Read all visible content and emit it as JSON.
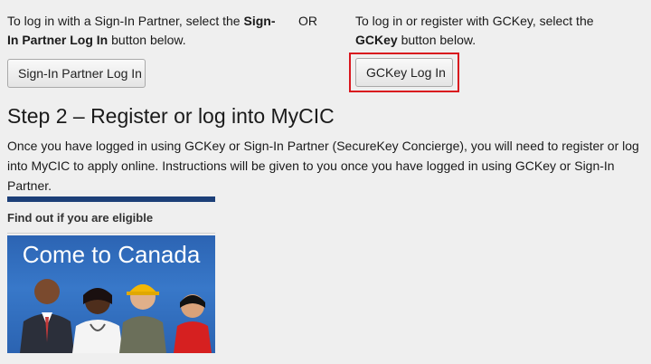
{
  "signin_partner": {
    "instruction_prefix": "To log in with a Sign-In Partner, select the ",
    "instruction_bold": "Sign-In Partner Log In",
    "instruction_suffix": " button below.",
    "button_label": "Sign-In Partner Log In"
  },
  "or_label": "OR",
  "gckey": {
    "instruction_prefix": "To log in or register with GCKey, select the ",
    "instruction_bold": "GCKey",
    "instruction_suffix": " button below.",
    "button_label": "GCKey Log In",
    "highlight_color": "#d9161e"
  },
  "step2": {
    "heading": "Step 2 – Register or log into MyCIC",
    "paragraph": "Once you have logged in using GCKey or Sign-In Partner (SecureKey Concierge), you will need to register or log into MyCIC to apply online. Instructions will be given to you once you have logged in using GCKey or Sign-In Partner."
  },
  "eligibility": {
    "title": "Find out if you are eligible",
    "banner_text": "Come to Canada",
    "bar_color": "#1c3f78"
  }
}
